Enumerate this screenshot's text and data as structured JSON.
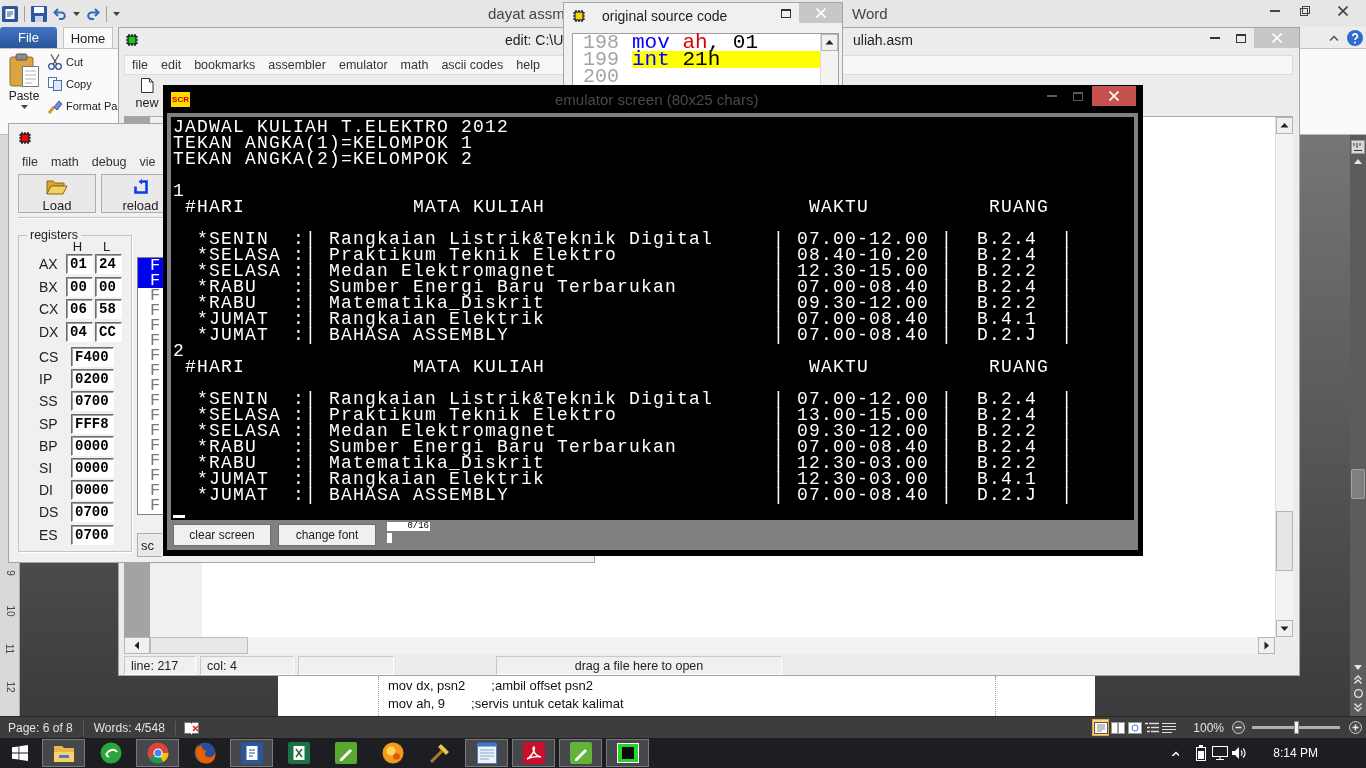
{
  "word": {
    "title_parts": [
      "dayat assm",
      "Word"
    ],
    "ribbon_tabs": [
      {
        "label": "File",
        "kind": "file",
        "selected": false
      },
      {
        "label": "Home",
        "kind": "tab",
        "selected": true
      }
    ],
    "clipboard": {
      "paste": "Paste",
      "cut": "Cut",
      "copy": "Copy",
      "format_painter": "Format Pa"
    },
    "ruler_numbers": [
      "9",
      "10",
      "11",
      "12"
    ],
    "document_lines": [
      {
        "code": "mov dx, psn2",
        "comment": ";ambil offset psn2"
      },
      {
        "code": "mov ah, 9",
        "comment": ";servis untuk cetak kalimat"
      }
    ],
    "status_bar": {
      "page": "Page: 6 of 8",
      "words": "Words: 4/548",
      "views": [
        {
          "selected": true
        },
        {
          "selected": false
        },
        {
          "selected": false
        },
        {
          "selected": false
        },
        {
          "selected": false
        }
      ],
      "zoom": "100%",
      "zoom_slider": {
        "level": 0.5
      }
    }
  },
  "editor": {
    "title_parts": [
      "edit: C:\\U",
      "uliah.asm"
    ],
    "menu": [
      "file",
      "edit",
      "bookmarks",
      "assembler",
      "emulator",
      "math",
      "ascii codes",
      "help"
    ],
    "toolbar": [
      {
        "label": "new"
      }
    ],
    "status_bar": {
      "line": "line: 217",
      "col": "col: 4",
      "hint": "drag a file here to open"
    }
  },
  "source_window": {
    "title": "original source code",
    "lines": [
      {
        "number": "198",
        "tokens": [
          {
            "text": "mov ",
            "kind": "keyword"
          },
          {
            "text": "ah",
            "kind": "register"
          },
          {
            "text": ", 01",
            "kind": "plain"
          }
        ],
        "selected": false
      },
      {
        "number": "199",
        "tokens": [
          {
            "text": "int ",
            "kind": "keyword"
          },
          {
            "text": "21h",
            "kind": "plain"
          }
        ],
        "selected": true
      },
      {
        "number": "200",
        "selected": false
      }
    ]
  },
  "emulator": {
    "menu": [
      "file",
      "math",
      "debug",
      "vie"
    ],
    "buttons": [
      {
        "label": "Load",
        "kind": "load"
      },
      {
        "label": "reload",
        "kind": "reload"
      }
    ],
    "registers_label": "registers",
    "byte_columns": [
      "H",
      "L"
    ],
    "byte_registers": [
      {
        "name": "AX",
        "high": "01",
        "low": "24"
      },
      {
        "name": "BX",
        "high": "00",
        "low": "00"
      },
      {
        "name": "CX",
        "high": "06",
        "low": "58"
      },
      {
        "name": "DX",
        "high": "04",
        "low": "CC"
      }
    ],
    "word_registers": [
      {
        "name": "CS",
        "value": "F400"
      },
      {
        "name": "IP",
        "value": "0200"
      },
      {
        "name": "SS",
        "value": "0700"
      },
      {
        "name": "SP",
        "value": "FFF8"
      },
      {
        "name": "BP",
        "value": "0000"
      },
      {
        "name": "SI",
        "value": "0000"
      },
      {
        "name": "DI",
        "value": "0000"
      },
      {
        "name": "DS",
        "value": "0700"
      },
      {
        "name": "ES",
        "value": "0700"
      }
    ],
    "memory_rows": [
      {
        "text": "F",
        "selected": true
      },
      {
        "text": "F",
        "selected": true
      },
      {
        "text": "F",
        "selected": false
      },
      {
        "text": "F",
        "selected": false
      },
      {
        "text": "F",
        "selected": false
      },
      {
        "text": "F",
        "selected": false
      },
      {
        "text": "F",
        "selected": false
      },
      {
        "text": "F",
        "selected": false
      },
      {
        "text": "F",
        "selected": false
      },
      {
        "text": "F",
        "selected": false
      },
      {
        "text": "F",
        "selected": false
      },
      {
        "text": "F",
        "selected": false
      },
      {
        "text": "F",
        "selected": false
      },
      {
        "text": "F",
        "selected": false
      },
      {
        "text": "F",
        "selected": false
      },
      {
        "text": "F",
        "selected": false
      },
      {
        "text": "F",
        "selected": false
      }
    ],
    "side_button": "sc"
  },
  "emulator_screen": {
    "logo": "SCR",
    "title": "emulator screen (80x25 chars)",
    "intro_lines": [
      "JADWAL KULIAH T.ELEKTRO 2012",
      "TEKAN ANGKA(1)=KELOMPOK 1",
      "TEKAN ANGKA(2)=KELOMPOK 2"
    ],
    "groups": [
      {
        "label": "1",
        "header": "#HARI              MATA KULIAH                      WAKTU          RUANG",
        "rows": [
          "*SENIN  :| Rangkaian Listrik&Teknik Digital     | 07.00-12.00 |  B.2.4  |",
          "*SELASA :| Praktikum Teknik Elektro             | 08.40-10.20 |  B.2.4  |",
          "*SELASA :| Medan Elektromagnet                  | 12.30-15.00 |  B.2.2  |",
          "*RABU   :| Sumber Energi Baru Terbarukan        | 07.00-08.40 |  B.2.4  |",
          "*RABU   :| Matematika_Diskrit                   | 09.30-12.00 |  B.2.2  |",
          "*JUMAT  :| Rangkaian Elektrik                   | 07.00-08.40 |  B.4.1  |",
          "*JUMAT  :| BAHASA ASSEMBLY                      | 07.00-08.40 |  D.2.J  |"
        ]
      },
      {
        "label": "2",
        "header": "#HARI              MATA KULIAH                      WAKTU          RUANG",
        "rows": [
          "*SENIN  :| Rangkaian Listrik&Teknik Digital     | 07.00-12.00 |  B.2.4  |",
          "*SELASA :| Praktikum Teknik Elektro             | 13.00-15.00 |  B.2.4  |",
          "*SELASA :| Medan Elektromagnet                  | 09.30-12.00 |  B.2.2  |",
          "*RABU   :| Sumber Energi Baru Terbarukan        | 07.00-08.40 |  B.2.4  |",
          "*RABU   :| Matematika_Diskrit                   | 12.30-03.00 |  B.2.2  |",
          "*JUMAT  :| Rangkaian Elektrik                   | 12.30-03.00 |  B.4.1  |",
          "*JUMAT  :| BAHASA ASSEMBLY                      | 07.00-08.40 |  D.2.J  |"
        ]
      }
    ],
    "buttons": [
      "clear screen",
      "change font"
    ],
    "buffer": "0/16"
  },
  "taskbar": {
    "apps": [
      {
        "running": true
      },
      {
        "running": false
      },
      {
        "running": true
      },
      {
        "running": false
      },
      {
        "running": true
      },
      {
        "running": false
      },
      {
        "running": false
      },
      {
        "running": false
      },
      {
        "running": false
      },
      {
        "running": true
      },
      {
        "running": true
      },
      {
        "running": true
      },
      {
        "running": true
      }
    ],
    "clock": "8:14 PM"
  }
}
